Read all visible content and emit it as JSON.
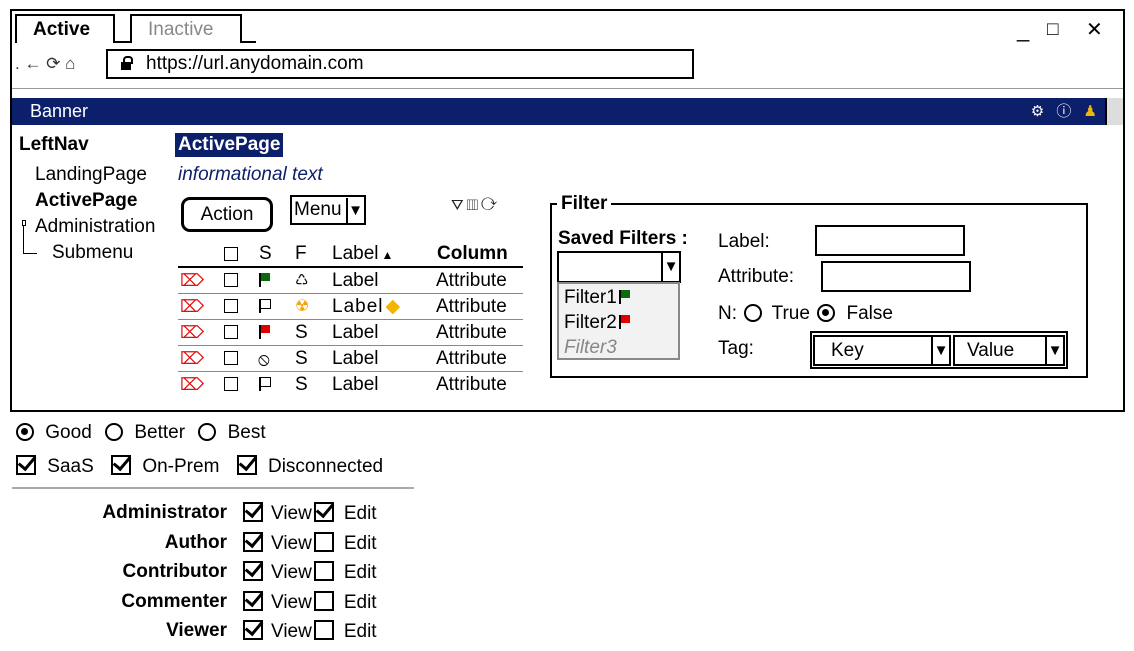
{
  "browser": {
    "tabs": [
      {
        "label": "Active",
        "active": true
      },
      {
        "label": "Inactive",
        "active": false
      }
    ],
    "window_controls": {
      "minimize": "_",
      "maximize": "□",
      "close": "✕"
    },
    "nav_prefix": ". ← ⟳ ⌂",
    "url": "https://url.anydomain.com"
  },
  "banner": {
    "title": "Banner",
    "icons": [
      "gear-icon",
      "info-icon",
      "user-icon"
    ]
  },
  "leftnav": {
    "heading": "LeftNav",
    "items": [
      {
        "label": "LandingPage"
      },
      {
        "label": "ActivePage"
      },
      {
        "label": "Administration"
      },
      {
        "label": "Submenu"
      }
    ]
  },
  "page": {
    "title": "ActivePage",
    "info": "informational text",
    "action_label": "Action",
    "menu_label": "Menu"
  },
  "grid": {
    "headers": {
      "s": "S",
      "f": "F",
      "label": "Label",
      "column": "Column"
    },
    "rows": [
      {
        "f_icon": "recycle-icon",
        "f": "♺",
        "label": "Label",
        "attr": "Attribute"
      },
      {
        "f_icon": "radioactive-icon",
        "f": "☢",
        "label": "Label",
        "attr": "Attribute"
      },
      {
        "f_icon": "none",
        "f": "S",
        "label": "Label",
        "attr": "Attribute"
      },
      {
        "f_icon": "none",
        "f": "S",
        "label": "Label",
        "attr": "Attribute"
      },
      {
        "f_icon": "none",
        "f": "S",
        "label": "Label",
        "attr": "Attribute"
      }
    ]
  },
  "filter": {
    "legend": "Filter",
    "saved_filters_label": "Saved Filters :",
    "saved_filters": [
      "Filter1",
      "Filter2",
      "Filter3"
    ],
    "label_field": "Label:",
    "attribute_field": "Attribute:",
    "n_label": "N:",
    "true_label": "True",
    "false_label": "False",
    "tag_label": "Tag:",
    "key_label": "Key",
    "value_label": "Value"
  },
  "options": {
    "radios": [
      "Good",
      "Better",
      "Best"
    ],
    "checks": [
      "SaaS",
      "On-Prem",
      "Disconnected"
    ]
  },
  "permissions": {
    "view": "View",
    "edit": "Edit",
    "roles": [
      {
        "name": "Administrator",
        "view": true,
        "edit": true
      },
      {
        "name": "Author",
        "view": true,
        "edit": false
      },
      {
        "name": "Contributor",
        "view": true,
        "edit": false
      },
      {
        "name": "Commenter",
        "view": true,
        "edit": false
      },
      {
        "name": "Viewer",
        "view": true,
        "edit": false
      }
    ]
  },
  "colors": {
    "banner": "#0c1f6a",
    "flag_green": "#0a6b0a",
    "flag_red": "#e00000",
    "delete": "#dd1111"
  }
}
